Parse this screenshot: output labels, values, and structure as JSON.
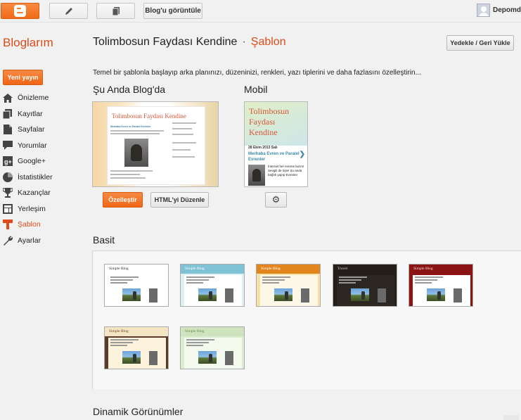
{
  "topbar": {
    "view_blog_label": "Blog'u görüntüle",
    "user_name": "Depomd"
  },
  "header": {
    "brand": "Bloglarım",
    "blog_title": "Tolimbosun Faydası Kendine",
    "separator": "·",
    "section": "Şablon",
    "backup_label": "Yedekle / Geri Yükle"
  },
  "sidebar": {
    "new_post_label": "Yeni yayın",
    "items": [
      {
        "label": "Önizleme",
        "icon": "home-icon"
      },
      {
        "label": "Kayıtlar",
        "icon": "posts-icon"
      },
      {
        "label": "Sayfalar",
        "icon": "pages-icon"
      },
      {
        "label": "Yorumlar",
        "icon": "comments-icon"
      },
      {
        "label": "Google+",
        "icon": "google-plus-icon"
      },
      {
        "label": "İstatistikler",
        "icon": "stats-icon"
      },
      {
        "label": "Kazançlar",
        "icon": "trophy-icon"
      },
      {
        "label": "Yerleşim",
        "icon": "layout-icon"
      },
      {
        "label": "Şablon",
        "icon": "template-icon",
        "active": true
      },
      {
        "label": "Ayarlar",
        "icon": "wrench-icon"
      }
    ]
  },
  "main": {
    "intro": "Temel bir şablonla başlayıp arka planınızı, düzeninizi, renkleri, yazı tiplerini ve daha fazlasını özelleştirin...",
    "current_label": "Şu Anda Blog'da",
    "mobile_label": "Mobil",
    "current_preview_title": "Tolimbosun Faydası Kendine",
    "current_preview_post": "Merhaba Evren ve Paralel Evrenler",
    "mobile_preview": {
      "title": "Tolimbosun Faydası Kendine",
      "date": "28 Ekim 2013 Salı",
      "post_title": "Merhaba Evren ve Paralel Evrenler",
      "excerpt": "İnternet her evrene lazım! Sevgili de öyle! Şu anda bağlık yapıp Evrenler"
    },
    "customize_label": "Özelleştir",
    "edit_html_label": "HTML'yi Düzenle",
    "basic_label": "Basit",
    "dynamic_label": "Dinamik Görünümler",
    "templates": [
      {
        "name": "Simple Blog",
        "bg": "#ffffff",
        "hdr": "#ffffff",
        "text": "#333333",
        "body": "#ffffff"
      },
      {
        "name": "Simple Blog",
        "bg": "#dff0f5",
        "hdr": "#7fc2d6",
        "text": "#ffffff",
        "body": "#ffffff"
      },
      {
        "name": "Simple Blog",
        "bg": "#f6e1a8",
        "hdr": "#e3851d",
        "text": "#ffffff",
        "body": "#fdf7e8"
      },
      {
        "name": "Travel",
        "bg": "#231e1a",
        "hdr": "#231e1a",
        "text": "#cccccc",
        "body": "#2d2724"
      },
      {
        "name": "Simple Blog",
        "bg": "#8a1313",
        "hdr": "#8a1313",
        "text": "#f3d6d6",
        "body": "#ffffff"
      },
      {
        "name": "Simple Blog",
        "bg": "#5a3a28",
        "hdr": "#f3e4c3",
        "text": "#6a4a2a",
        "body": "#fdf3dc"
      },
      {
        "name": "Simple Blog",
        "bg": "#dceccf",
        "hdr": "#cfe3be",
        "text": "#6a8a4a",
        "body": "#f4f9ee"
      }
    ]
  }
}
